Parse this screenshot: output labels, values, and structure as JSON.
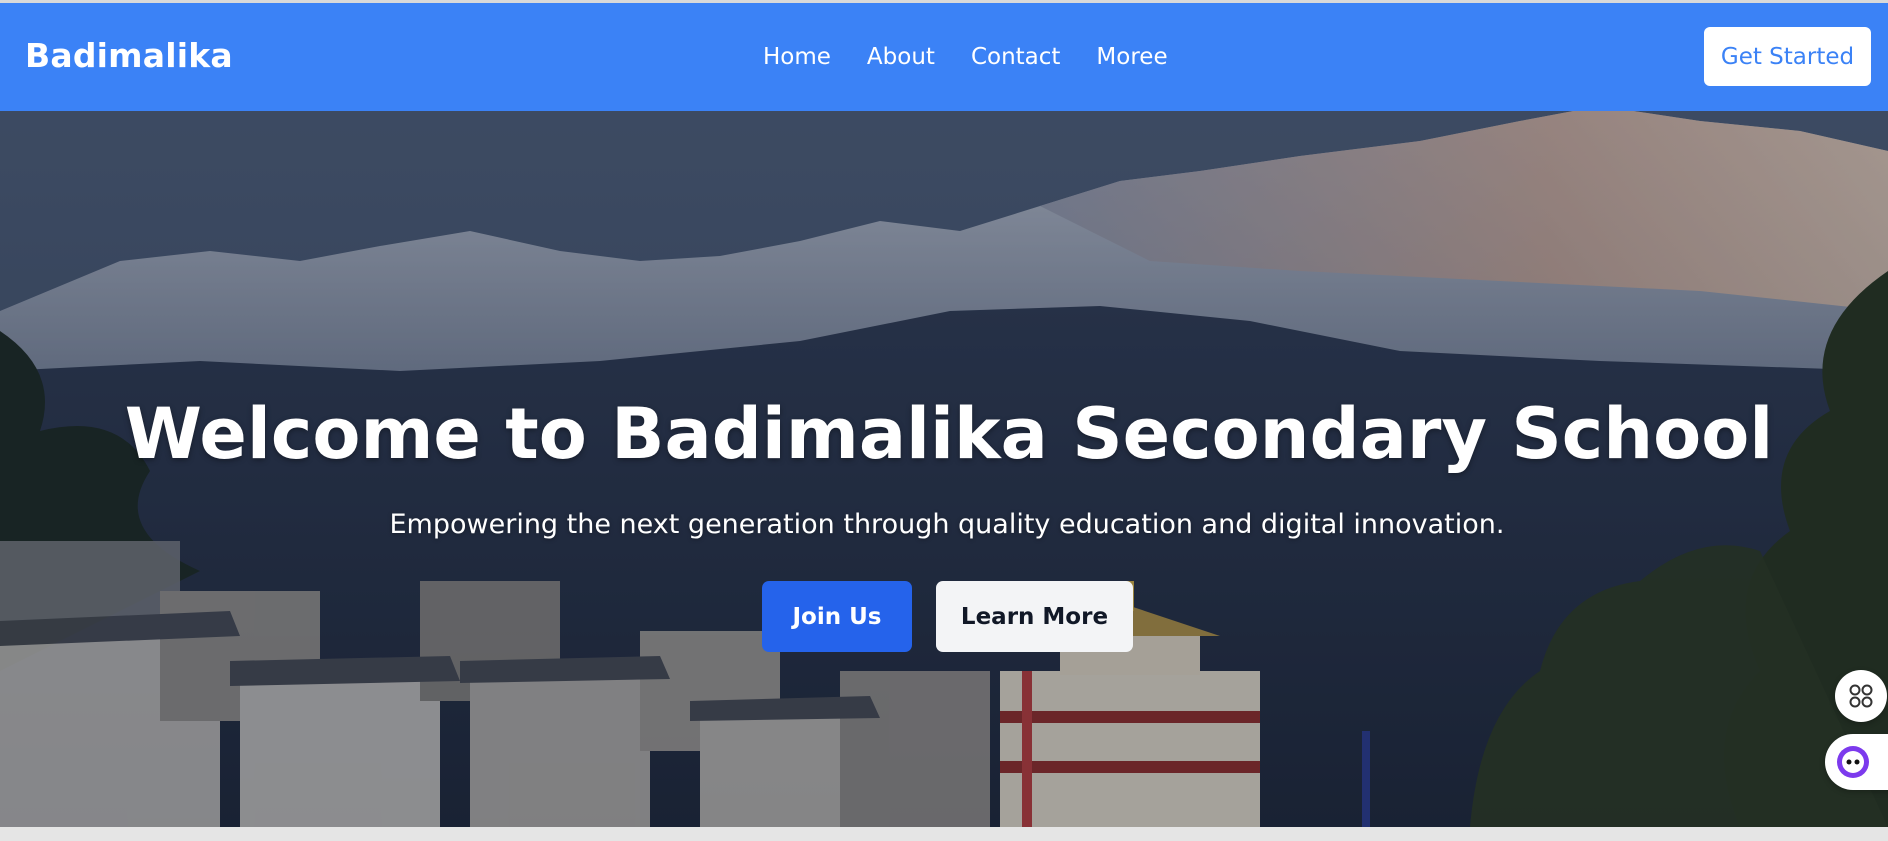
{
  "navbar": {
    "brand": "Badimalika",
    "links": [
      "Home",
      "About",
      "Contact",
      "Moree"
    ],
    "cta_label": "Get Started",
    "bg_color": "#3b82f6"
  },
  "hero": {
    "title": "Welcome to Badimalika Secondary School",
    "subtitle": "Empowering the next generation through quality education and digital innovation.",
    "primary_button": "Join Us",
    "secondary_button": "Learn More",
    "primary_color": "#2563eb",
    "background_image": "mountain-village-photo"
  },
  "floating_widgets": {
    "grid_icon": "apps-grid-icon",
    "assistant_icon": "assistant-bot-icon"
  }
}
